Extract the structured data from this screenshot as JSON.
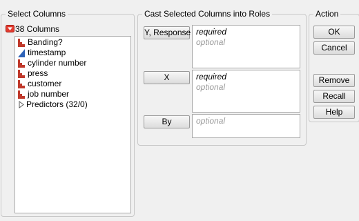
{
  "select_columns": {
    "title": "Select Columns",
    "count_label": "38 Columns",
    "columns": [
      {
        "label": "Banding?",
        "icon": "nominal-icon"
      },
      {
        "label": "timestamp",
        "icon": "continuous-icon"
      },
      {
        "label": "cylinder number",
        "icon": "nominal-icon"
      },
      {
        "label": "press",
        "icon": "nominal-icon"
      },
      {
        "label": "customer",
        "icon": "nominal-icon"
      },
      {
        "label": "job number",
        "icon": "nominal-icon"
      }
    ],
    "group_label": "Predictors (32/0)"
  },
  "cast_roles": {
    "title": "Cast Selected Columns into Roles",
    "roles": [
      {
        "button": "Y, Response",
        "required": "required",
        "optional": "optional"
      },
      {
        "button": "X",
        "required": "required",
        "optional": "optional"
      },
      {
        "button": "By",
        "optional": "optional"
      }
    ]
  },
  "action": {
    "title": "Action",
    "ok": "OK",
    "cancel": "Cancel",
    "remove": "Remove",
    "recall": "Recall",
    "help": "Help"
  },
  "colors": {
    "nominal_icon": "#c0392b",
    "continuous_icon": "#2e63b8",
    "collapse_icon": "#d0312d"
  }
}
